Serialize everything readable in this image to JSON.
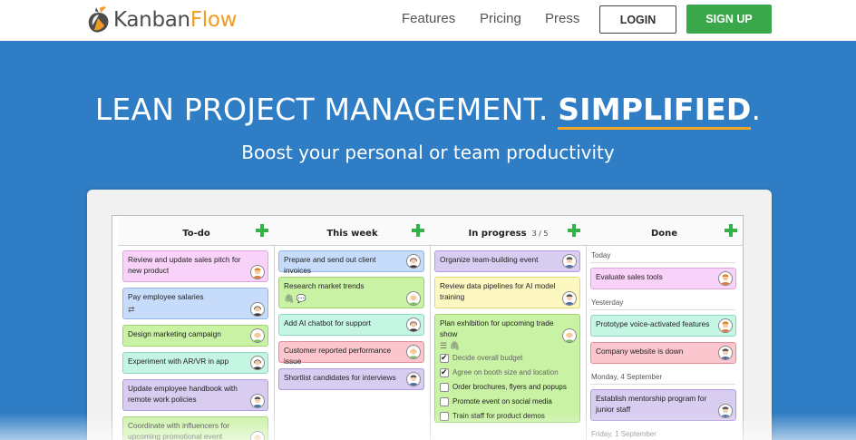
{
  "nav": {
    "logo": {
      "part1": "Kanban",
      "part2": "Flow",
      "colors": {
        "part1": "#4d4d4d",
        "part2": "#f29b21"
      }
    },
    "links": [
      "Features",
      "Pricing",
      "Press"
    ],
    "login_label": "LOGIN",
    "signup_label": "SIGN UP"
  },
  "hero": {
    "title_start": "LEAN PROJECT MANAGEMENT. ",
    "title_highlight": "SIMPLIFIED",
    "title_end": ".",
    "subtitle": "Boost your personal or team productivity"
  },
  "colors": {
    "hero_bg": "#2f7dc4",
    "signup": "#3aa84a",
    "accent_underline": "#f5a623",
    "add_plus": "#33b24a"
  },
  "board": {
    "columns": [
      {
        "name": "To-do",
        "tasks": [
          {
            "text": "Review and update sales pitch for new product",
            "color": "pink",
            "avatar": "person-man-1"
          },
          {
            "text": "Pay employee salaries",
            "color": "blue",
            "avatar": "person-woman-1",
            "icons": "⇄"
          },
          {
            "text": "Design marketing campaign",
            "color": "green",
            "avatar": "person-woman-2"
          },
          {
            "text": "Experiment with AR/VR in app",
            "color": "teal",
            "avatar": "person-woman-1"
          },
          {
            "text": "Update employee handbook with remote work policies",
            "color": "purple",
            "avatar": "person-man-2"
          },
          {
            "text": "Coordinate with influencers for upcoming promotional event",
            "color": "green",
            "avatar": "person-woman-2"
          }
        ]
      },
      {
        "name": "This week",
        "tasks": [
          {
            "text": "Prepare and send out client invoices",
            "color": "blue",
            "avatar": "person-woman-1"
          },
          {
            "text": "Research market trends",
            "color": "green",
            "avatar": "person-woman-2",
            "icons": "🖇 💬"
          },
          {
            "text": "Add AI chatbot for support",
            "color": "teal",
            "avatar": "person-woman-1"
          },
          {
            "text": "Customer reported performance issue",
            "color": "red",
            "avatar": "person-woman-2"
          },
          {
            "text": "Shortlist candidates for interviews",
            "color": "purple",
            "avatar": "person-man-2"
          }
        ]
      },
      {
        "name": "In progress",
        "wip": "3 / 5",
        "tasks": [
          {
            "text": "Organize team-building event",
            "color": "purple",
            "avatar": "person-man-2"
          },
          {
            "text": "Review data pipelines for AI model training",
            "color": "yellow",
            "avatar": "person-man-2"
          },
          {
            "text": "Plan exhibition for upcoming trade show",
            "color": "green",
            "avatar": "person-woman-2",
            "icons": "☰ 🖇",
            "checklist": [
              {
                "text": "Decide overall budget",
                "done": true
              },
              {
                "text": "Agree on booth size and location",
                "done": true
              },
              {
                "text": "Order brochures, flyers and popups",
                "done": false
              },
              {
                "text": "Promote event on social media",
                "done": false
              },
              {
                "text": "Train staff for product demos",
                "done": false
              }
            ]
          }
        ]
      },
      {
        "name": "Done",
        "groups": [
          {
            "label": "Today",
            "tasks": [
              {
                "text": "Evaluate sales tools",
                "color": "pink",
                "avatar": "person-man-1"
              }
            ]
          },
          {
            "label": "Yesterday",
            "tasks": [
              {
                "text": "Prototype voice-activated features",
                "color": "teal",
                "avatar": "person-man-1"
              },
              {
                "text": "Company website is down",
                "color": "red",
                "avatar": "person-man-2"
              }
            ]
          },
          {
            "label": "Monday, 4 September",
            "tasks": [
              {
                "text": "Establish mentorship program for junior staff",
                "color": "purple",
                "avatar": "person-man-2"
              }
            ]
          },
          {
            "label": "Friday, 1 September",
            "tasks": []
          }
        ]
      }
    ]
  }
}
